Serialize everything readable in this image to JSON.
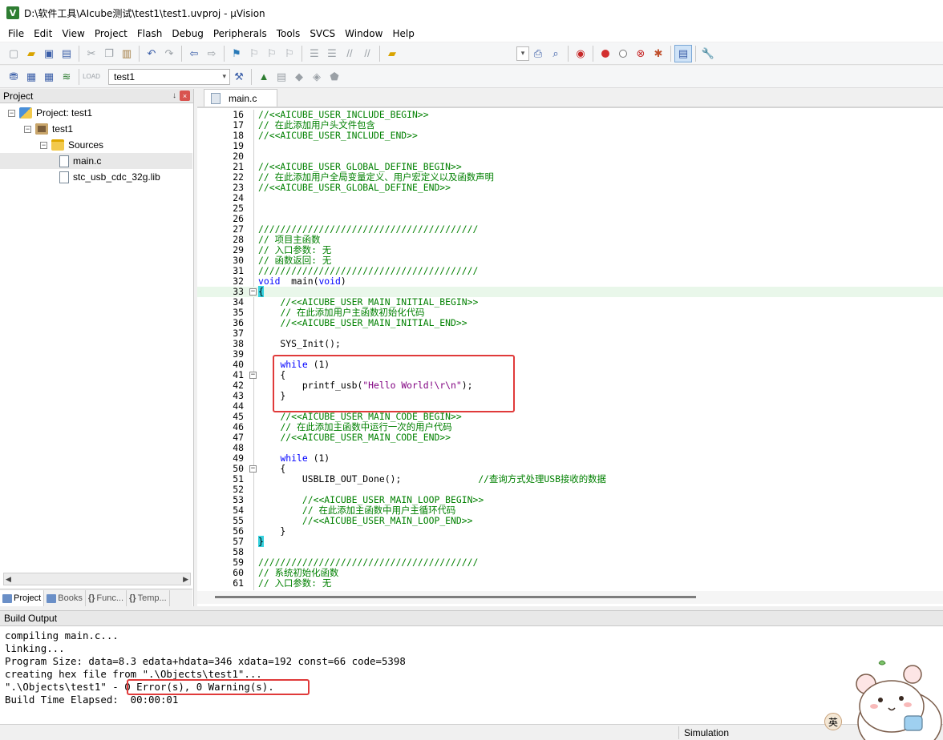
{
  "window": {
    "title": "D:\\软件工具\\AIcube测试\\test1\\test1.uvproj - µVision",
    "icon_letter": "V"
  },
  "menu": [
    "File",
    "Edit",
    "View",
    "Project",
    "Flash",
    "Debug",
    "Peripherals",
    "Tools",
    "SVCS",
    "Window",
    "Help"
  ],
  "toolbar": {
    "target_name": "test1",
    "icons": [
      "new-file-icon",
      "open-icon",
      "save-icon",
      "save-all-icon",
      "cut-icon",
      "copy-icon",
      "paste-icon",
      "undo-icon",
      "redo-icon",
      "back-icon",
      "forward-icon",
      "bookmark-icon",
      "prev-bookmark-icon",
      "next-bookmark-icon",
      "clear-bookmarks-icon",
      "indent-icon",
      "unindent-icon",
      "comment-icon",
      "uncomment-icon",
      "find-in-files-icon",
      "find-icon",
      "breakpoint-icon",
      "disable-breakpoint-icon",
      "kill-breakpoints-icon",
      "configure-icon",
      "window-layout-icon",
      "tools-icon"
    ],
    "load_label": "LOAD"
  },
  "project_panel": {
    "title": "Project",
    "pin_glyph": "↓",
    "close_glyph": "×",
    "tree": [
      {
        "label": "Project: test1",
        "level": 0,
        "icon": "project-icon"
      },
      {
        "label": "test1",
        "level": 1,
        "icon": "target-icon"
      },
      {
        "label": "Sources",
        "level": 2,
        "icon": "folder-icon"
      },
      {
        "label": "main.c",
        "level": 3,
        "icon": "c-file-icon",
        "selected": true
      },
      {
        "label": "stc_usb_cdc_32g.lib",
        "level": 3,
        "icon": "lib-file-icon"
      }
    ],
    "tabs": [
      "Project",
      "Books",
      "Func...",
      "Temp..."
    ],
    "tab_prefixes": [
      "",
      "",
      "{}",
      "{}"
    ]
  },
  "editor": {
    "tab_label": "main.c",
    "highlight_line": 33,
    "lines": [
      {
        "n": 16,
        "segs": [
          [
            "c-com",
            "//<<AICUBE_USER_INCLUDE_BEGIN>>"
          ]
        ]
      },
      {
        "n": 17,
        "segs": [
          [
            "c-com",
            "// 在此添加用户头文件包含"
          ]
        ]
      },
      {
        "n": 18,
        "segs": [
          [
            "c-com",
            "//<<AICUBE_USER_INCLUDE_END>>"
          ]
        ]
      },
      {
        "n": 19,
        "segs": []
      },
      {
        "n": 20,
        "segs": []
      },
      {
        "n": 21,
        "segs": [
          [
            "c-com",
            "//<<AICUBE_USER_GLOBAL_DEFINE_BEGIN>>"
          ]
        ]
      },
      {
        "n": 22,
        "segs": [
          [
            "c-com",
            "// 在此添加用户全局变量定义、用户宏定义以及函数声明"
          ]
        ]
      },
      {
        "n": 23,
        "segs": [
          [
            "c-com",
            "//<<AICUBE_USER_GLOBAL_DEFINE_END>>"
          ]
        ]
      },
      {
        "n": 24,
        "segs": []
      },
      {
        "n": 25,
        "segs": []
      },
      {
        "n": 26,
        "segs": []
      },
      {
        "n": 27,
        "segs": [
          [
            "c-com",
            "////////////////////////////////////////"
          ]
        ]
      },
      {
        "n": 28,
        "segs": [
          [
            "c-com",
            "// 项目主函数"
          ]
        ]
      },
      {
        "n": 29,
        "segs": [
          [
            "c-com",
            "// 入口参数: 无"
          ]
        ]
      },
      {
        "n": 30,
        "segs": [
          [
            "c-com",
            "// 函数返回: 无"
          ]
        ]
      },
      {
        "n": 31,
        "segs": [
          [
            "c-com",
            "////////////////////////////////////////"
          ]
        ]
      },
      {
        "n": 32,
        "segs": [
          [
            "c-kw",
            "void"
          ],
          [
            "",
            "  main("
          ],
          [
            "c-kw",
            "void"
          ],
          [
            "",
            ")"
          ]
        ]
      },
      {
        "n": 33,
        "fold": "-",
        "segs": [
          [
            "brace-hl",
            "{"
          ]
        ]
      },
      {
        "n": 34,
        "segs": [
          [
            "",
            "    "
          ],
          [
            "c-com",
            "//<<AICUBE_USER_MAIN_INITIAL_BEGIN>>"
          ]
        ]
      },
      {
        "n": 35,
        "segs": [
          [
            "",
            "    "
          ],
          [
            "c-com",
            "// 在此添加用户主函数初始化代码"
          ]
        ]
      },
      {
        "n": 36,
        "segs": [
          [
            "",
            "    "
          ],
          [
            "c-com",
            "//<<AICUBE_USER_MAIN_INITIAL_END>>"
          ]
        ]
      },
      {
        "n": 37,
        "segs": []
      },
      {
        "n": 38,
        "segs": [
          [
            "",
            "    SYS_Init();"
          ]
        ]
      },
      {
        "n": 39,
        "segs": []
      },
      {
        "n": 40,
        "segs": [
          [
            "",
            "    "
          ],
          [
            "c-kw",
            "while"
          ],
          [
            "",
            " (1)"
          ]
        ]
      },
      {
        "n": 41,
        "fold": "-",
        "segs": [
          [
            "",
            "    {"
          ]
        ]
      },
      {
        "n": 42,
        "segs": [
          [
            "",
            "        printf_usb("
          ],
          [
            "c-str",
            "\"Hello World!\\r\\n\""
          ],
          [
            "",
            ");"
          ]
        ]
      },
      {
        "n": 43,
        "segs": [
          [
            "",
            "    }"
          ]
        ]
      },
      {
        "n": 44,
        "segs": []
      },
      {
        "n": 45,
        "segs": [
          [
            "",
            "    "
          ],
          [
            "c-com",
            "//<<AICUBE_USER_MAIN_CODE_BEGIN>>"
          ]
        ]
      },
      {
        "n": 46,
        "segs": [
          [
            "",
            "    "
          ],
          [
            "c-com",
            "// 在此添加主函数中运行一次的用户代码"
          ]
        ]
      },
      {
        "n": 47,
        "segs": [
          [
            "",
            "    "
          ],
          [
            "c-com",
            "//<<AICUBE_USER_MAIN_CODE_END>>"
          ]
        ]
      },
      {
        "n": 48,
        "segs": []
      },
      {
        "n": 49,
        "segs": [
          [
            "",
            "    "
          ],
          [
            "c-kw",
            "while"
          ],
          [
            "",
            " (1)"
          ]
        ]
      },
      {
        "n": 50,
        "fold": "-",
        "segs": [
          [
            "",
            "    {"
          ]
        ]
      },
      {
        "n": 51,
        "segs": [
          [
            "",
            "        USBLIB_OUT_Done();              "
          ],
          [
            "c-com",
            "//查询方式处理USB接收的数据"
          ]
        ]
      },
      {
        "n": 52,
        "segs": []
      },
      {
        "n": 53,
        "segs": [
          [
            "",
            "        "
          ],
          [
            "c-com",
            "//<<AICUBE_USER_MAIN_LOOP_BEGIN>>"
          ]
        ]
      },
      {
        "n": 54,
        "segs": [
          [
            "",
            "        "
          ],
          [
            "c-com",
            "// 在此添加主函数中用户主循环代码"
          ]
        ]
      },
      {
        "n": 55,
        "segs": [
          [
            "",
            "        "
          ],
          [
            "c-com",
            "//<<AICUBE_USER_MAIN_LOOP_END>>"
          ]
        ]
      },
      {
        "n": 56,
        "segs": [
          [
            "",
            "    }"
          ]
        ]
      },
      {
        "n": 57,
        "segs": [
          [
            "brace-hl",
            "}"
          ]
        ]
      },
      {
        "n": 58,
        "segs": []
      },
      {
        "n": 59,
        "segs": [
          [
            "c-com",
            "////////////////////////////////////////"
          ]
        ]
      },
      {
        "n": 60,
        "segs": [
          [
            "c-com",
            "// 系统初始化函数"
          ]
        ]
      },
      {
        "n": 61,
        "segs": [
          [
            "c-com",
            "// 入口参数: 无"
          ]
        ]
      }
    ]
  },
  "build_output": {
    "title": "Build Output",
    "lines": [
      "compiling main.c...",
      "linking...",
      "Program Size: data=8.3 edata+hdata=346 xdata=192 const=66 code=5398",
      "creating hex file from \".\\Objects\\test1\"...",
      "\".\\Objects\\test1\" - 0 Error(s), 0 Warning(s).",
      "Build Time Elapsed:  00:00:01"
    ]
  },
  "status": {
    "mode": "Simulation",
    "ime": "英"
  }
}
